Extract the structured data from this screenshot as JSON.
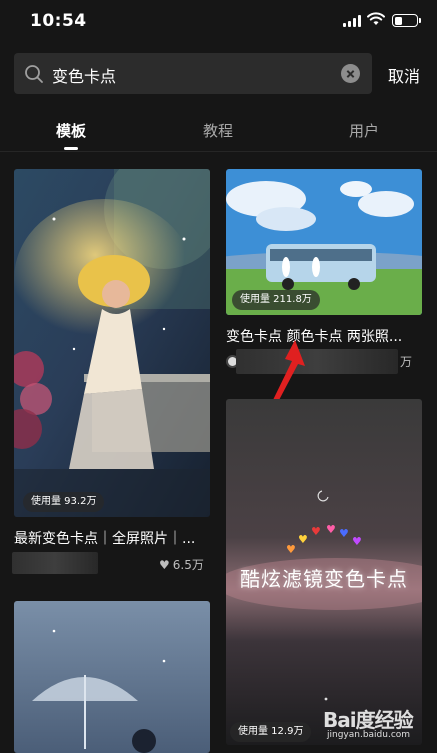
{
  "status_bar": {
    "time": "10:54"
  },
  "search": {
    "query": "变色卡点",
    "cancel_label": "取消"
  },
  "tabs": [
    {
      "label": "模板",
      "active": true
    },
    {
      "label": "教程",
      "active": false
    },
    {
      "label": "用户",
      "active": false
    }
  ],
  "cards": [
    {
      "usage": "使用量  93.2万",
      "title": "最新变色卡点｜全屏照片｜...",
      "likes": "6.5万",
      "overlay": ""
    },
    {
      "usage": "使用量  211.8万",
      "title": "变色卡点 颜色卡点 两张照...",
      "likes": "万",
      "overlay": ""
    },
    {
      "usage": "使用量  12.9万",
      "title": "",
      "likes": "",
      "overlay": "酷炫滤镜变色卡点"
    },
    {
      "usage": "",
      "title": "",
      "likes": "",
      "overlay": ""
    }
  ],
  "watermark": {
    "logo": "Bai度经验",
    "url": "jingyan.baidu.com"
  },
  "colors": {
    "background": "#161616",
    "search_bg": "#2c2c2c",
    "arrow": "#e02020"
  }
}
